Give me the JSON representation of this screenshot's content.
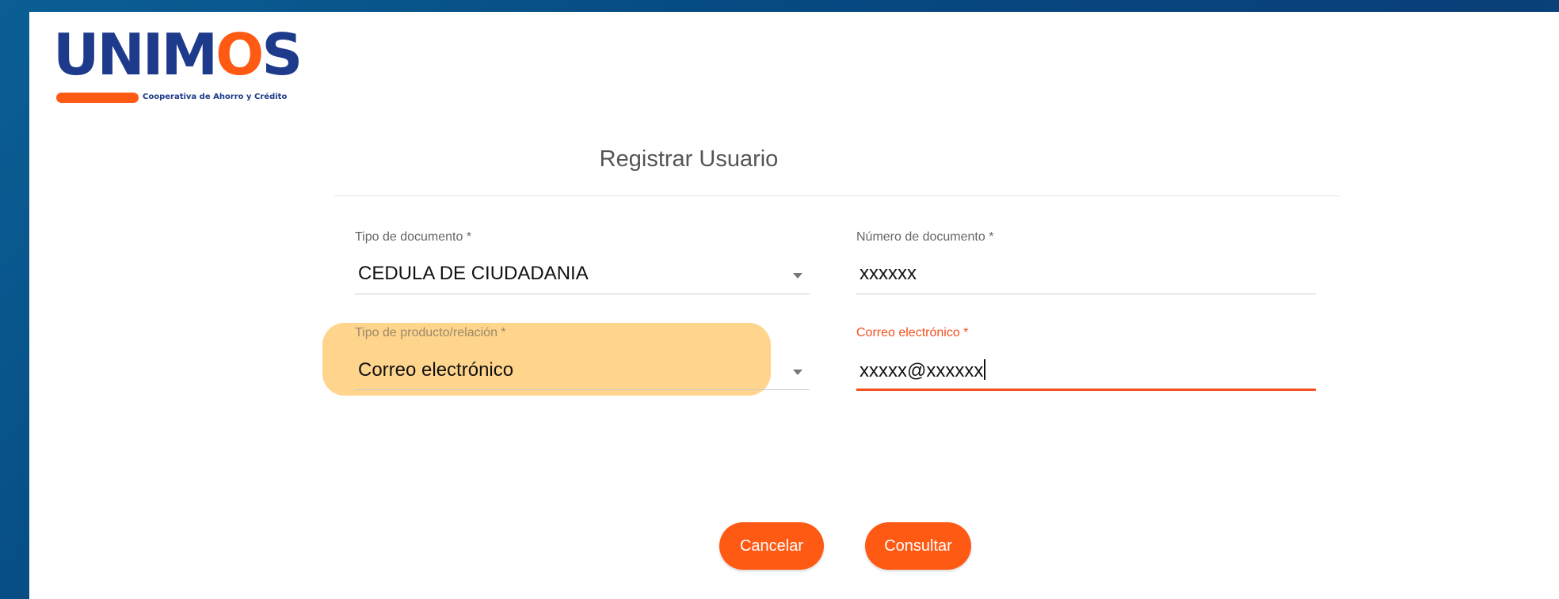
{
  "logo": {
    "brand_prefix": "UNIM",
    "brand_o": "O",
    "brand_suffix": "S",
    "tagline": "Cooperativa de Ahorro y Crédito"
  },
  "form": {
    "title": "Registrar Usuario",
    "tipo_documento": {
      "label": "Tipo de documento *",
      "value": "CEDULA DE CIUDADANIA"
    },
    "numero_documento": {
      "label": "Número de documento *",
      "value": "xxxxxx"
    },
    "tipo_producto": {
      "label": "Tipo de producto/relación *",
      "value": "Correo electrónico"
    },
    "correo": {
      "label": "Correo electrónico *",
      "value": "xxxxx@xxxxxx"
    }
  },
  "buttons": {
    "cancel_label": "Cancelar",
    "submit_label": "Consultar"
  },
  "colors": {
    "accent": "#ff5a14",
    "brand_blue": "#1e3a8a",
    "highlight": "#ffb840"
  }
}
